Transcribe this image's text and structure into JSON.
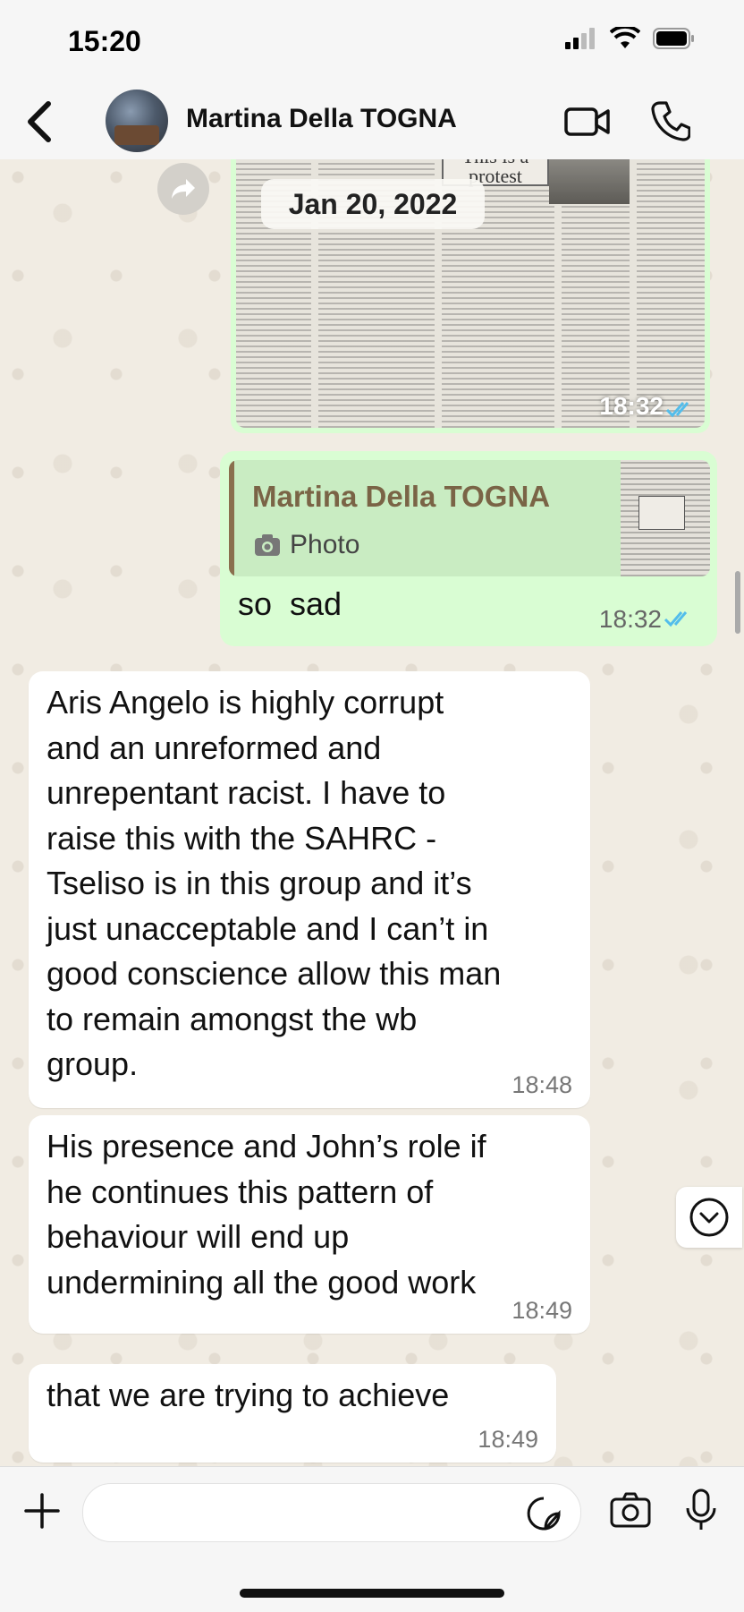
{
  "status_bar": {
    "time": "15:20"
  },
  "header": {
    "contact_name": "Martina Della TOGNA"
  },
  "chat": {
    "date_pill": "Jan 20, 2022",
    "image_message": {
      "time": "18:32",
      "visible_headline": "This is a\nprotest"
    },
    "reply_message": {
      "quoted_name": "Martina Della TOGNA",
      "quoted_type": "Photo",
      "text": "so  sad",
      "time": "18:32"
    },
    "incoming": [
      {
        "text": "Aris Angelo is highly corrupt\nand an unreformed and\nunrepentant racist. I have to\nraise this with the SAHRC -\nTseliso is in this group and it’s\njust unacceptable and I can’t in\ngood conscience allow this man\nto remain amongst the wb\ngroup.",
        "time": "18:48"
      },
      {
        "text": "His presence and John’s role if\nhe continues this pattern of\nbehaviour will end up\nundermining all the good work",
        "time": "18:49"
      },
      {
        "text": "that we are trying to achieve",
        "time": "18:49"
      }
    ]
  },
  "input_bar": {
    "placeholder": ""
  },
  "colors": {
    "outgoing_bubble": "#d9fdd3",
    "incoming_bubble": "#ffffff",
    "read_ticks": "#53bdeb",
    "quote_accent": "#8a6f4e"
  },
  "icons": [
    "back-icon",
    "video-call-icon",
    "phone-icon",
    "forward-icon",
    "camera-icon",
    "read-receipt-icon",
    "chevron-down-icon",
    "plus-icon",
    "sticker-icon",
    "microphone-icon"
  ]
}
